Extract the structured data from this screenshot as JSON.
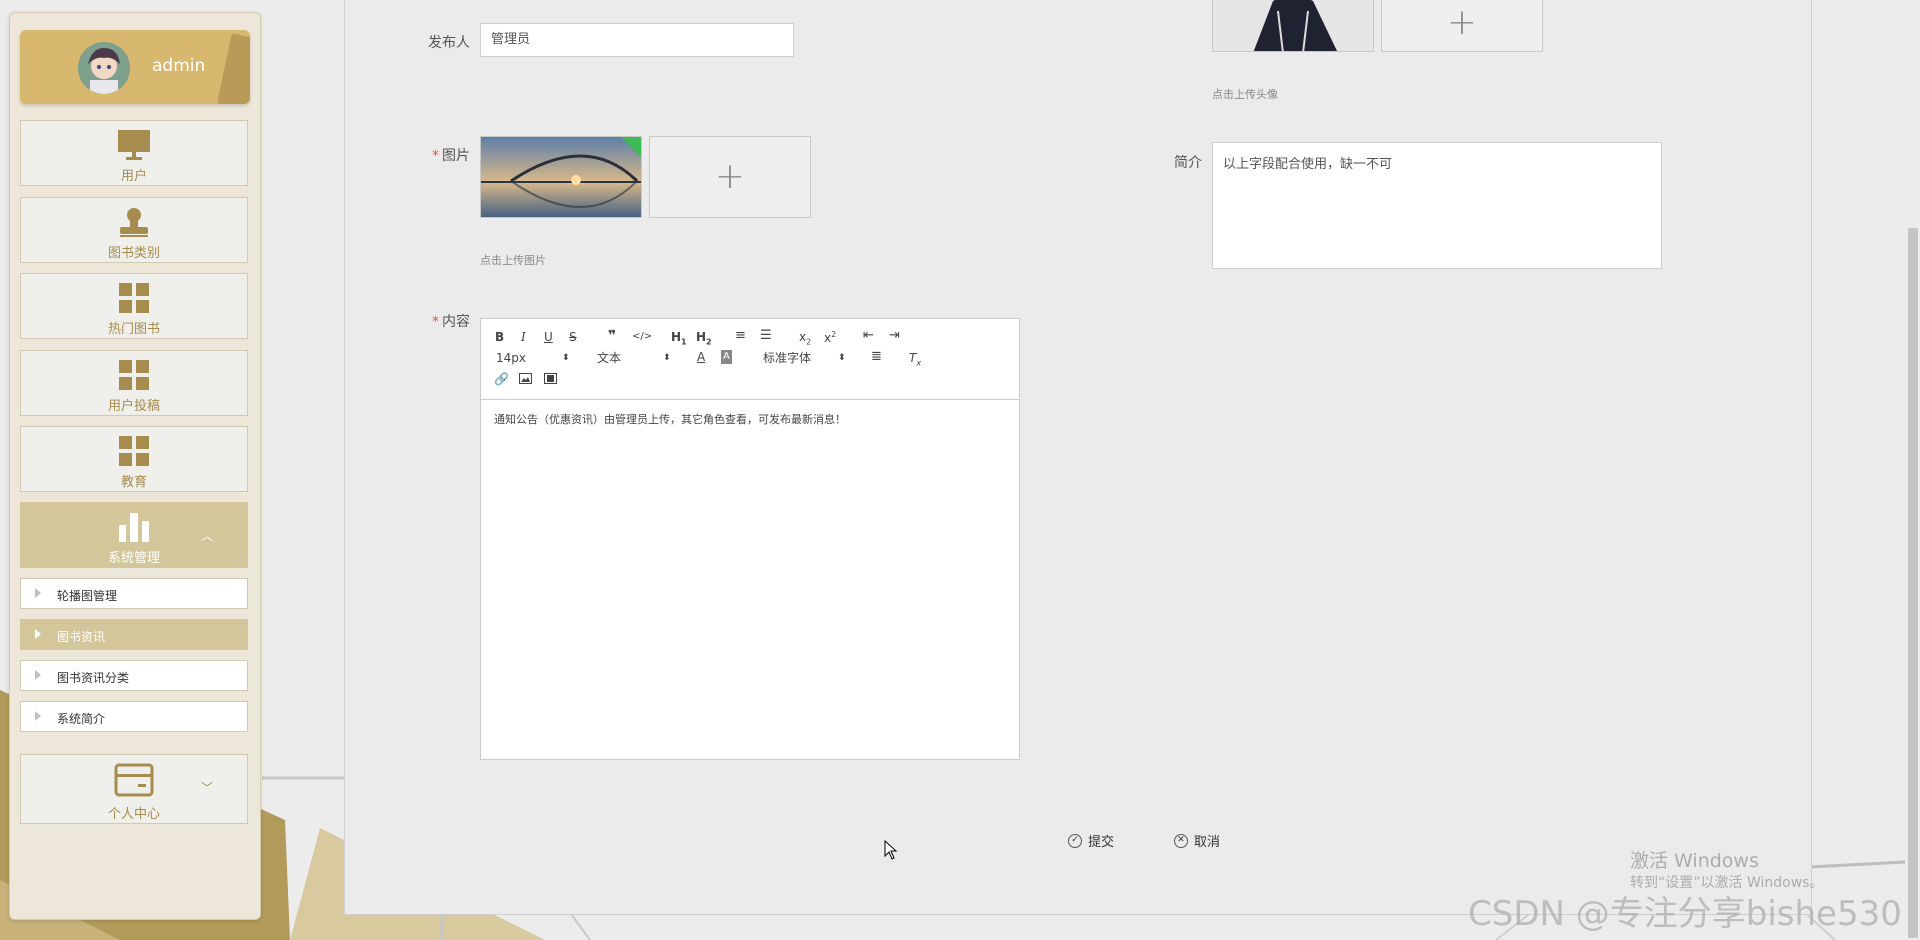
{
  "sidebar": {
    "username": "admin",
    "nav": [
      {
        "label": "用户",
        "icon": "monitor-icon"
      },
      {
        "label": "图书类别",
        "icon": "stamp-icon"
      },
      {
        "label": "热门图书",
        "icon": "grid-icon"
      },
      {
        "label": "用户投稿",
        "icon": "grid-icon"
      },
      {
        "label": "教育",
        "icon": "grid-icon"
      },
      {
        "label": "系统管理",
        "icon": "bar-chart-icon"
      },
      {
        "label": "个人中心",
        "icon": "card-icon"
      }
    ],
    "sub_items": [
      "轮播图管理",
      "图书资讯",
      "图书资讯分类",
      "系统简介"
    ]
  },
  "form": {
    "publisher_label": "发布人",
    "publisher_value": "管理员",
    "image_label": "图片",
    "image_hint": "点击上传图片",
    "avatar_hint": "点击上传头像",
    "intro_label": "简介",
    "intro_value": "以上字段配合使用，缺一不可",
    "content_label": "内容",
    "required_mark": "*"
  },
  "editor": {
    "font_size": "14px",
    "header_select": "文本",
    "font_family": "标准字体",
    "content": "通知公告（优惠资讯）由管理员上传，其它角色查看，可发布最新消息！"
  },
  "buttons": {
    "submit": "提交",
    "cancel": "取消"
  },
  "watermark": {
    "line1": "激活 Windows",
    "line2": "转到“设置”以激活 Windows。",
    "csdn": "CSDN @专注分享bishe530"
  },
  "colors": {
    "accent": "#d4c69b",
    "gold": "#b29b5a",
    "icon": "#a68c4e"
  }
}
